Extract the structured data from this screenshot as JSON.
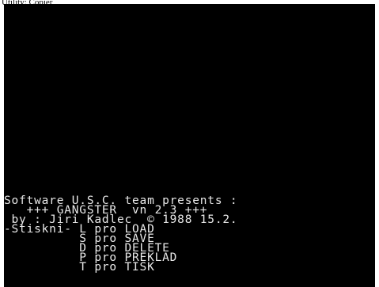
{
  "caption": "Utility: Copier",
  "screen": {
    "lines": [
      "Software U.S.C. team presents :",
      "   +++ GANGSTER  vn 2.3 +++",
      " by : Jiri Kadlec  © 1988 15.2.",
      "-Stiskni- L pro LOAD",
      "          S pro SAVE",
      "          D pro DELETE",
      "          P pro PREKLAD",
      "          T pro TISK"
    ]
  },
  "colors": {
    "screen_background": "#000000",
    "text": "#e8e8e8",
    "page_background": "#ffffff"
  }
}
